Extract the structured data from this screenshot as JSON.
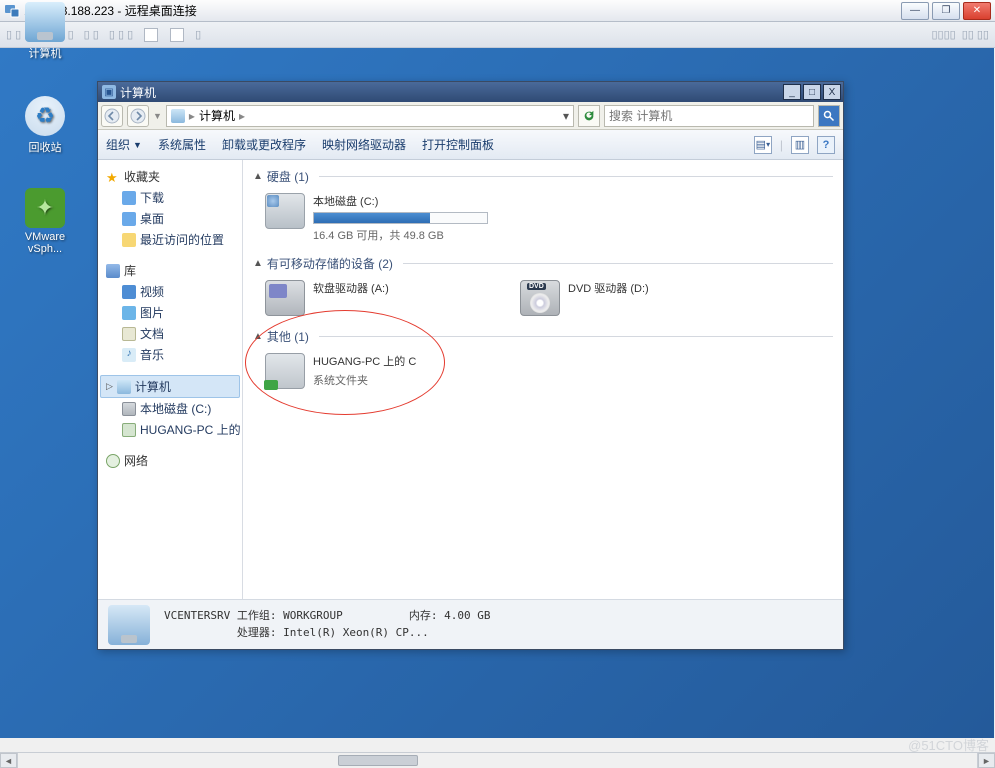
{
  "outer": {
    "title": "188.188.188.223 - 远程桌面连接",
    "controls": {
      "min": "—",
      "max": "❐",
      "close": "✕"
    }
  },
  "desktop": {
    "computer": "计算机",
    "recycle": "回收站",
    "vmware": "VMware vSph..."
  },
  "explorer": {
    "title": "计算机",
    "address_text": "计算机",
    "search_placeholder": "搜索 计算机",
    "controls": {
      "min": "_",
      "max": "□",
      "close": "X"
    },
    "toolbar": {
      "organize": "组织",
      "system_props": "系统属性",
      "uninstall": "卸载或更改程序",
      "map_drive": "映射网络驱动器",
      "control_panel": "打开控制面板"
    },
    "nav": {
      "favorites": {
        "label": "收藏夹",
        "downloads": "下载",
        "desktop": "桌面",
        "recent": "最近访问的位置"
      },
      "libraries": {
        "label": "库",
        "videos": "视频",
        "pictures": "图片",
        "documents": "文档",
        "music": "音乐"
      },
      "computer": {
        "label": "计算机",
        "local_c": "本地磁盘 (C:)",
        "hugang_c": "HUGANG-PC 上的 C"
      },
      "network": {
        "label": "网络"
      }
    },
    "content": {
      "hdd_section": "硬盘 (1)",
      "local_disk": {
        "name": "本地磁盘 (C:)",
        "detail": "16.4 GB 可用，共 49.8 GB",
        "used_pct": 67
      },
      "removable_section": "有可移动存储的设备 (2)",
      "floppy": "软盘驱动器 (A:)",
      "dvd": "DVD 驱动器 (D:)",
      "other_section": "其他 (1)",
      "hugang": {
        "line1": "HUGANG-PC 上的 C",
        "line2": "系统文件夹"
      }
    },
    "status": {
      "line1": "VCENTERSRV 工作组: WORKGROUP          内存: 4.00 GB",
      "line2": "           处理器: Intel(R) Xeon(R) CP..."
    }
  },
  "watermark": "@51CTO博客"
}
